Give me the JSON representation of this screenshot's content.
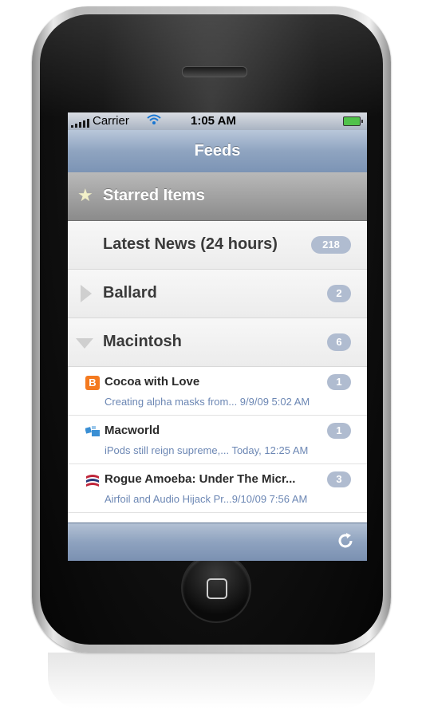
{
  "status_bar": {
    "carrier": "Carrier",
    "time": "1:05 AM",
    "signal_icon": "signal-bars-icon",
    "wifi_icon": "wifi-icon",
    "battery_icon": "battery-icon"
  },
  "nav_bar": {
    "title": "Feeds"
  },
  "rows": {
    "starred": {
      "label": "Starred Items",
      "icon": "star-icon"
    },
    "latest": {
      "label": "Latest News (24 hours)",
      "count": "218"
    },
    "ballard": {
      "label": "Ballard",
      "count": "2",
      "icon": "disclosure-right-icon"
    },
    "macintosh": {
      "label": "Macintosh",
      "count": "6",
      "icon": "disclosure-down-icon"
    }
  },
  "feeds": [
    {
      "title": "Cocoa with Love",
      "subtitle": "Creating alpha masks from... 9/9/09 5:02 AM",
      "count": "1",
      "icon": "blogger-icon",
      "icon_color": "#f47a20"
    },
    {
      "title": "Macworld",
      "subtitle": "iPods still reign supreme,... Today, 12:25 AM",
      "count": "1",
      "icon": "macworld-icon",
      "icon_color": "#3a8fd4"
    },
    {
      "title": "Rogue Amoeba: Under The Micr...",
      "subtitle": "Airfoil and Audio Hijack Pr...9/10/09 7:56 AM",
      "count": "3",
      "icon": "rogue-amoeba-icon",
      "icon_color": "#c0263a"
    }
  ],
  "toolbar": {
    "refresh_icon": "refresh-icon"
  },
  "colors": {
    "nav_bar": "#8fa4c0",
    "badge": "#b0bcd0",
    "subtitle_text": "#6c87b4",
    "starred_row": "#9e9e9e"
  }
}
